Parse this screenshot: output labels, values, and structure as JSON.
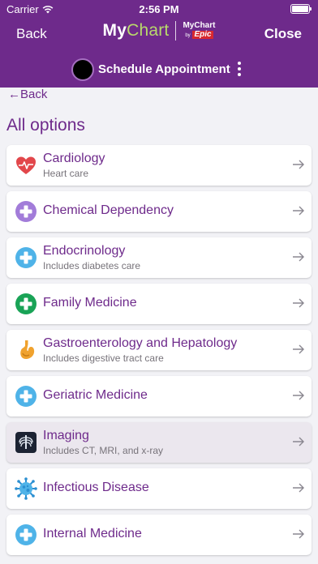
{
  "status": {
    "carrier": "Carrier",
    "time": "2:56 PM"
  },
  "nav": {
    "back": "Back",
    "close": "Close",
    "logo_my": "My",
    "logo_chart": "Chart",
    "logo_small_top": "MyChart",
    "logo_small_by": "by",
    "logo_small_epic": "Epic"
  },
  "subheader": {
    "title": "Schedule Appointment"
  },
  "content": {
    "back_link": "←Back",
    "section_title": "All options",
    "items": [
      {
        "title": "Cardiology",
        "desc": "Heart care",
        "icon": "heart-icon"
      },
      {
        "title": "Chemical Dependency",
        "desc": "",
        "icon": "plus-circle-icon"
      },
      {
        "title": "Endocrinology",
        "desc": "Includes diabetes care",
        "icon": "plus-circle-icon"
      },
      {
        "title": "Family Medicine",
        "desc": "",
        "icon": "plus-circle-icon"
      },
      {
        "title": "Gastroenterology and Hepatology",
        "desc": "Includes digestive tract care",
        "icon": "stomach-icon"
      },
      {
        "title": "Geriatric Medicine",
        "desc": "",
        "icon": "plus-circle-icon"
      },
      {
        "title": "Imaging",
        "desc": "Includes CT, MRI, and x-ray",
        "icon": "xray-icon"
      },
      {
        "title": "Infectious Disease",
        "desc": "",
        "icon": "virus-icon"
      },
      {
        "title": "Internal Medicine",
        "desc": "",
        "icon": "plus-circle-icon"
      }
    ]
  },
  "colors": {
    "brand": "#6e2a8b",
    "accent": "#b8d96b",
    "heart": "#e2474b",
    "chemical": "#a27cd9",
    "endo": "#4fb3e8",
    "family": "#19a356",
    "geriatric": "#4fb3e8",
    "internal": "#4fb3e8"
  }
}
